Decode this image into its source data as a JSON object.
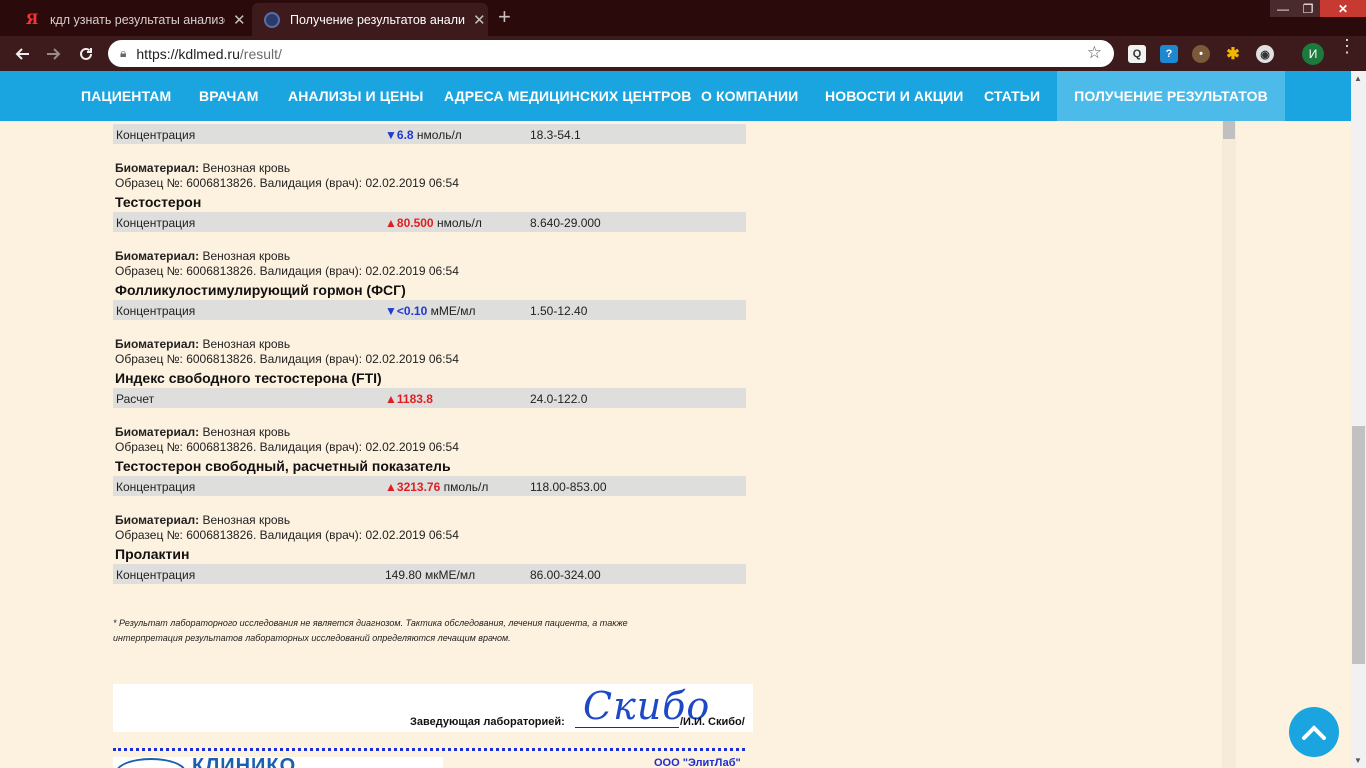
{
  "browser": {
    "tabs": [
      {
        "icon": "yandex-icon",
        "icon_glyph": "Я",
        "title": "кдл узнать результаты анализов",
        "close": "✕"
      },
      {
        "icon": "globe-icon",
        "title": "Получение результатов анализов",
        "close": "✕"
      }
    ],
    "new_tab": "+",
    "window": {
      "minimize": "—",
      "maximize": "❐",
      "close": "✕"
    },
    "url_host": "https://kdlmed.ru",
    "url_path": "/result/",
    "profile_initial": "И"
  },
  "site_nav": {
    "items": [
      "ПАЦИЕНТАМ",
      "ВРАЧАМ",
      "АНАЛИЗЫ И ЦЕНЫ",
      "АДРЕСА МЕДИЦИНСКИХ ЦЕНТРОВ",
      "О КОМПАНИИ",
      "НОВОСТИ И АКЦИИ",
      "СТАТЬИ",
      "ПОЛУЧЕНИЕ РЕЗУЛЬТАТОВ"
    ],
    "active": "ПОЛУЧЕНИЕ РЕЗУЛЬТАТОВ"
  },
  "results": {
    "first_row": {
      "param": "Концентрация",
      "flag": "down",
      "arrow": "▼",
      "value": "6.8",
      "unit": "нмоль/л",
      "ref": "18.3-54.1"
    },
    "biomaterial_label": "Биоматериал:",
    "tests": [
      {
        "biomaterial": "Венозная кровь",
        "sample": "Образец №: 6006813826. Валидация (врач): 02.02.2019 06:54",
        "title": "Тестостерон",
        "row": {
          "param": "Концентрация",
          "flag": "up",
          "arrow": "▲",
          "value": "80.500",
          "unit": "нмоль/л",
          "ref": "8.640-29.000"
        }
      },
      {
        "biomaterial": "Венозная кровь",
        "sample": "Образец №: 6006813826. Валидация (врач): 02.02.2019 06:54",
        "title": "Фолликулостимулирующий гормон (ФСГ)",
        "row": {
          "param": "Концентрация",
          "flag": "down",
          "arrow": "▼",
          "value": "<0.10",
          "unit": "мМЕ/мл",
          "ref": "1.50-12.40"
        }
      },
      {
        "biomaterial": "Венозная кровь",
        "sample": "Образец №: 6006813826. Валидация (врач): 02.02.2019 06:54",
        "title": "Индекс свободного тестостерона (FTI)",
        "row": {
          "param": "Расчет",
          "flag": "up",
          "arrow": "▲",
          "value": "1183.8",
          "unit": "",
          "ref": "24.0-122.0"
        }
      },
      {
        "biomaterial": "Венозная кровь",
        "sample": "Образец №: 6006813826. Валидация (врач): 02.02.2019 06:54",
        "title": "Тестостерон свободный, расчетный показатель",
        "row": {
          "param": "Концентрация",
          "flag": "up",
          "arrow": "▲",
          "value": "3213.76",
          "unit": "пмоль/л",
          "ref": "118.00-853.00"
        }
      },
      {
        "biomaterial": "Венозная кровь",
        "sample": "Образец №: 6006813826. Валидация (врач): 02.02.2019 06:54",
        "title": "Пролактин",
        "row": {
          "param": "Концентрация",
          "flag": "none",
          "arrow": "",
          "value": "149.80",
          "unit": "мкМЕ/мл",
          "ref": "86.00-324.00"
        }
      }
    ]
  },
  "note": {
    "line1": "* Результат лабораторного исследования не является диагнозом. Тактика обследования, лечения пациента, а также",
    "line2": "интерпретация результатов лабораторных исследований определяются лечащим врачом."
  },
  "signature": {
    "label": "Заведующая лабораторией:",
    "handwritten": "Скибо",
    "name": "/И.И. Скибо/"
  },
  "footer": {
    "logo_text": "КЛИНИКО",
    "org": "ООО \"ЭлитЛаб\""
  },
  "colors": {
    "nav": "#1aa5e0",
    "high": "#e02020",
    "low": "#1f3ad0",
    "page_bg": "#fdf1df"
  }
}
